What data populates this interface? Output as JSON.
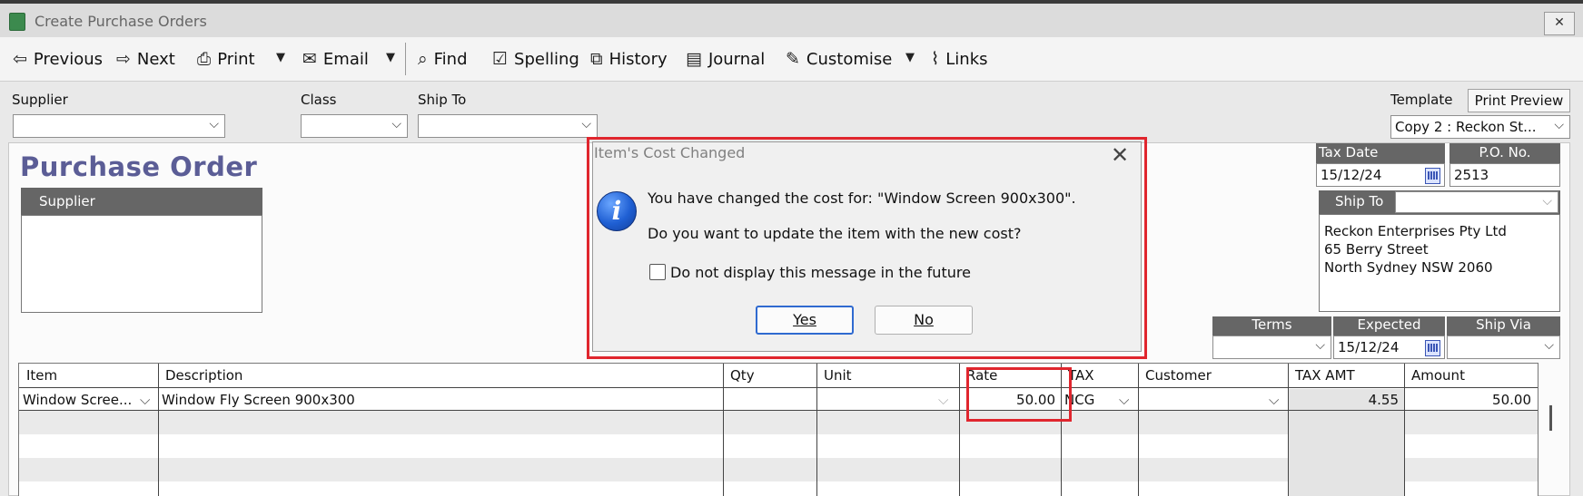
{
  "window": {
    "title": "Create Purchase Orders",
    "close": "✕"
  },
  "toolbar": {
    "previous": "Previous",
    "next": "Next",
    "print": "Print",
    "email": "Email",
    "find": "Find",
    "spelling": "Spelling",
    "history": "History",
    "journal": "Journal",
    "customise": "Customise",
    "links": "Links"
  },
  "header": {
    "supplier_label": "Supplier",
    "supplier_value": "",
    "class_label": "Class",
    "class_value": "",
    "shipto_label": "Ship To",
    "shipto_value": "",
    "template_label": "Template",
    "print_preview": "Print Preview",
    "template_value": "Copy 2 : Reckon St..."
  },
  "form": {
    "title": "Purchase Order",
    "supplier_box_label": "Supplier",
    "tax_date_label": "Tax Date",
    "tax_date": "15/12/24",
    "po_no_label": "P.O. No.",
    "po_no": "2513",
    "ship_to_label": "Ship To",
    "ship_to_value": "",
    "ship_to_address": [
      "Reckon Enterprises Pty Ltd",
      "65 Berry Street",
      "North Sydney NSW 2060"
    ],
    "terms_label": "Terms",
    "terms_value": "",
    "expected_label": "Expected",
    "expected_value": "15/12/24",
    "ship_via_label": "Ship Via",
    "ship_via_value": ""
  },
  "table": {
    "headers": [
      "Item",
      "Description",
      "Qty",
      "Unit",
      "Rate",
      "TAX",
      "Customer",
      "TAX AMT",
      "Amount"
    ],
    "rows": [
      {
        "item": "Window Scree...",
        "description": "Window Fly Screen 900x300",
        "qty": "",
        "unit": "",
        "rate": "50.00",
        "tax": "NCG",
        "customer": "",
        "tax_amt": "4.55",
        "amount": "50.00"
      }
    ]
  },
  "dialog": {
    "title": "Item's Cost Changed",
    "line1": "You have changed the cost for: \"Window Screen 900x300\".",
    "line2": "Do you want to update the item with the new cost?",
    "checkbox_label": "Do not display this message in the future",
    "yes": "Yes",
    "no": "No"
  },
  "colors": {
    "highlight": "#e0262e",
    "title_purple": "#5b5d96",
    "header_gray": "#666666",
    "info_blue": "#1f5fd3"
  }
}
